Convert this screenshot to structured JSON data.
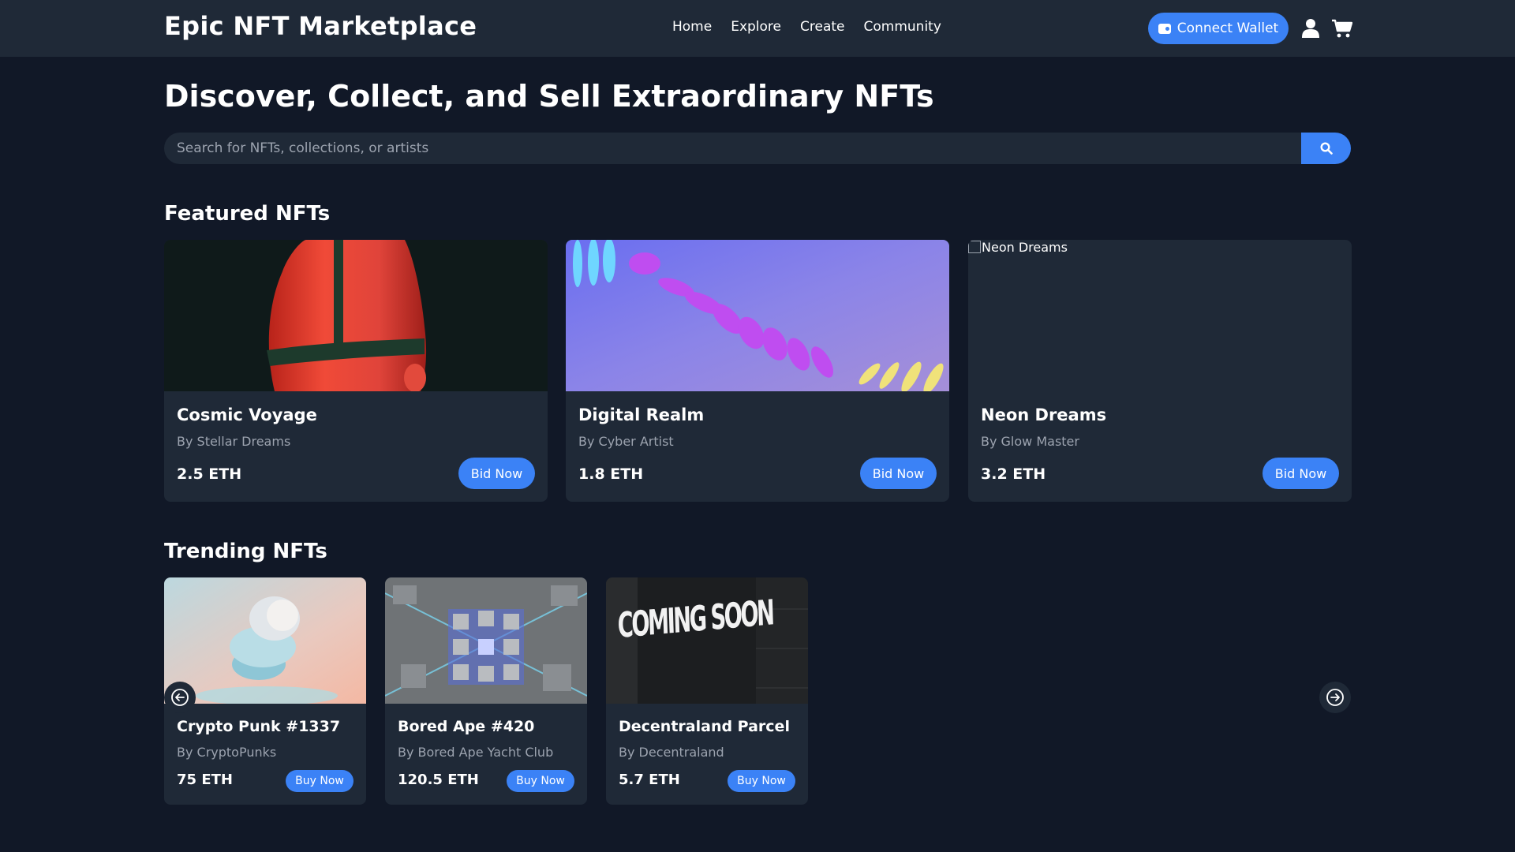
{
  "header": {
    "brand": "Epic NFT Marketplace",
    "nav": [
      "Home",
      "Explore",
      "Create",
      "Community"
    ],
    "wallet_label": "Connect Wallet"
  },
  "hero": {
    "title": "Discover, Collect, and Sell Extraordinary NFTs",
    "search_placeholder": "Search for NFTs, collections, or artists"
  },
  "featured": {
    "title": "Featured NFTs",
    "items": [
      {
        "name": "Cosmic Voyage",
        "artist": "By Stellar Dreams",
        "price": "2.5 ETH",
        "cta": "Bid Now"
      },
      {
        "name": "Digital Realm",
        "artist": "By Cyber Artist",
        "price": "1.8 ETH",
        "cta": "Bid Now"
      },
      {
        "name": "Neon Dreams",
        "artist": "By Glow Master",
        "price": "3.2 ETH",
        "cta": "Bid Now",
        "alt": "Neon Dreams"
      }
    ]
  },
  "trending": {
    "title": "Trending NFTs",
    "items": [
      {
        "name": "Crypto Punk #1337",
        "artist": "By CryptoPunks",
        "price": "75 ETH",
        "cta": "Buy Now"
      },
      {
        "name": "Bored Ape #420",
        "artist": "By Bored Ape Yacht Club",
        "price": "120.5 ETH",
        "cta": "Buy Now"
      },
      {
        "name": "Decentraland Parcel",
        "artist": "By Decentraland",
        "price": "5.7 ETH",
        "cta": "Buy Now",
        "image_text": "COMING SOON"
      }
    ]
  },
  "colors": {
    "background": "#111827",
    "surface": "#1f2937",
    "accent": "#3b82f6",
    "muted": "#9ca3af"
  },
  "icons": [
    "wallet-icon",
    "user-icon",
    "cart-icon",
    "search-icon",
    "arrow-left-icon",
    "arrow-right-icon"
  ]
}
